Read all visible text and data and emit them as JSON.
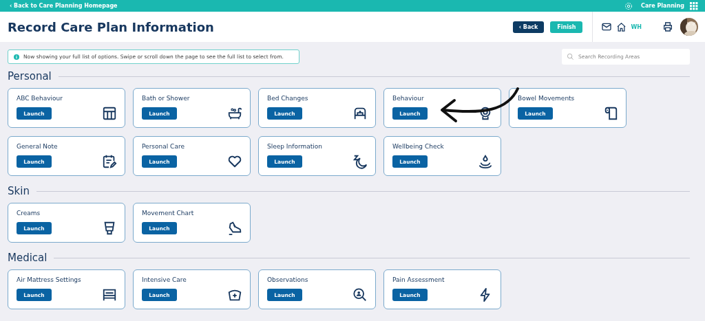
{
  "top_bar": {
    "back_link": "‹ Back to Care Planning Homepage",
    "app_name": "Care Planning"
  },
  "header": {
    "title": "Record Care Plan Information",
    "back_button": "‹ Back",
    "finish_button": "Finish",
    "home_label": "WH"
  },
  "info_banner": "Now showing your full list of options. Swipe or scroll down the page to see the full list to select from.",
  "search": {
    "placeholder": "Search Recording Areas"
  },
  "sections": [
    {
      "title": "Personal",
      "cards": [
        {
          "label": "ABC Behaviour",
          "button": "Launch"
        },
        {
          "label": "Bath or Shower",
          "button": "Launch"
        },
        {
          "label": "Bed Changes",
          "button": "Launch"
        },
        {
          "label": "Behaviour",
          "button": "Launch"
        },
        {
          "label": "Bowel Movements",
          "button": "Launch"
        },
        {
          "label": "General Note",
          "button": "Launch"
        },
        {
          "label": "Personal Care",
          "button": "Launch"
        },
        {
          "label": "Sleep Information",
          "button": "Launch"
        },
        {
          "label": "Wellbeing Check",
          "button": "Launch"
        }
      ]
    },
    {
      "title": "Skin",
      "cards": [
        {
          "label": "Creams",
          "button": "Launch"
        },
        {
          "label": "Movement Chart",
          "button": "Launch"
        }
      ]
    },
    {
      "title": "Medical",
      "cards": [
        {
          "label": "Air Mattress Settings",
          "button": "Launch"
        },
        {
          "label": "Intensive Care",
          "button": "Launch"
        },
        {
          "label": "Observations",
          "button": "Launch"
        },
        {
          "label": "Pain Assessment",
          "button": "Launch"
        }
      ]
    }
  ]
}
